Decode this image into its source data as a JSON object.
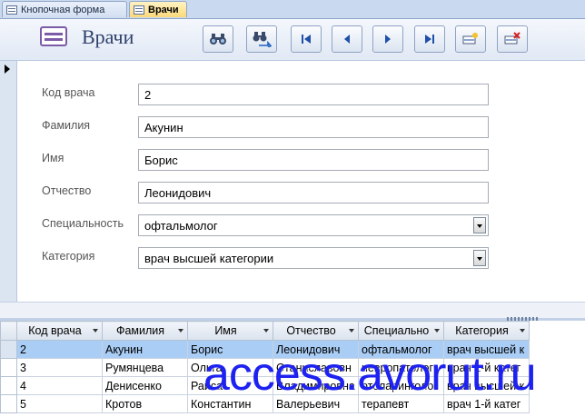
{
  "tabs": [
    {
      "label": "Кнопочная форма",
      "active": false
    },
    {
      "label": "Врачи",
      "active": true
    }
  ],
  "header": {
    "title": "Врачи",
    "buttons": [
      {
        "name": "find-button",
        "icon": "binoculars-icon"
      },
      {
        "name": "replace-button",
        "icon": "binoculars-arrow-icon"
      },
      {
        "name": "first-record-button",
        "icon": "first-record-icon"
      },
      {
        "name": "previous-record-button",
        "icon": "previous-record-icon"
      },
      {
        "name": "next-record-button",
        "icon": "next-record-icon"
      },
      {
        "name": "last-record-button",
        "icon": "last-record-icon"
      },
      {
        "name": "new-record-button",
        "icon": "new-record-icon"
      },
      {
        "name": "delete-record-button",
        "icon": "delete-record-icon"
      }
    ]
  },
  "form": {
    "fields": [
      {
        "label": "Код врача",
        "value": "2",
        "type": "text"
      },
      {
        "label": "Фамилия",
        "value": "Акунин",
        "type": "text"
      },
      {
        "label": "Имя",
        "value": "Борис",
        "type": "text"
      },
      {
        "label": "Отчество",
        "value": "Леонидович",
        "type": "text"
      },
      {
        "label": "Специальность",
        "value": "офтальмолог",
        "type": "combo"
      },
      {
        "label": "Категория",
        "value": "врач высшей категории",
        "type": "combo"
      }
    ]
  },
  "datasheet": {
    "columns": [
      "Код врача",
      "Фамилия",
      "Имя",
      "Отчество",
      "Специально",
      "Категория"
    ],
    "rows": [
      [
        "2",
        "Акунин",
        "Борис",
        "Леонидович",
        "офтальмолог",
        "врач высшей к"
      ],
      [
        "3",
        "Румянцева",
        "Ольга",
        "Станиславовн",
        "невропатолог",
        "врач 1-й катег"
      ],
      [
        "4",
        "Денисенко",
        "Раиса",
        "Владимировна",
        "отоларинголог",
        "врач высшей к"
      ],
      [
        "5",
        "Кротов",
        "Константин",
        "Валерьевич",
        "терапевт",
        "врач 1-й катег"
      ]
    ],
    "current_row": 0
  },
  "watermark": "access.avorut.ru",
  "colors": {
    "accent": "#2d3f6b",
    "selected_row": "#a9cdf5",
    "watermark": "#1e22f0"
  }
}
